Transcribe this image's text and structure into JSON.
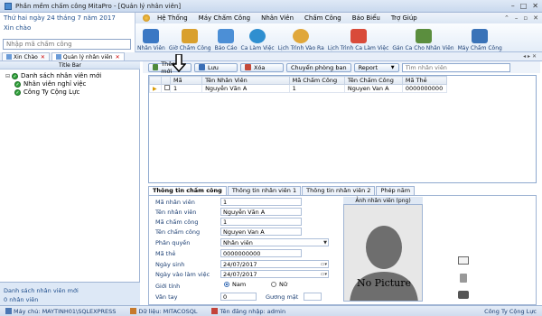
{
  "window": {
    "title": "Phần mềm chấm công MitaPro - [Quản lý nhân viên]"
  },
  "left_header": {
    "date": "Thứ hai ngày 24 tháng 7 năm 2017",
    "greeting": "Xin chào",
    "search_placeholder": "Nhập mã chấm công"
  },
  "menu": {
    "items": [
      "Hệ Thống",
      "Máy Chấm Công",
      "Nhân Viên",
      "Chấm Công",
      "Báo Biểu",
      "Trợ Giúp"
    ]
  },
  "ribbon": {
    "buttons": [
      {
        "label": "Nhân Viên",
        "color": "#3b78c4"
      },
      {
        "label": "Giờ Chấm Công",
        "color": "#d9a02e"
      },
      {
        "label": "Báo Cáo",
        "color": "#4c8fd6"
      },
      {
        "label": "Ca Làm Việc",
        "color": "#2f8fd0"
      },
      {
        "label": "Lịch Trình Vào Ra",
        "color": "#e0a73b"
      },
      {
        "label": "Lịch Trình Ca Làm Việc",
        "color": "#d94b3a"
      },
      {
        "label": "Gán Ca Cho Nhân Viên",
        "color": "#5b8e3e"
      },
      {
        "label": "Máy Chấm Công",
        "color": "#3a73b8"
      }
    ]
  },
  "doc_tabs": [
    {
      "label": "Xin Chào"
    },
    {
      "label": "Quản lý nhân viên"
    }
  ],
  "tree": {
    "header": "Title Bar",
    "items": [
      "Danh sách nhân viên mới",
      "Nhân viên nghỉ việc",
      "Công Ty Cộng Lực"
    ]
  },
  "left_footer": {
    "line1": "Danh sách nhân viên mới",
    "line2": "0 nhân viên"
  },
  "toolbar": {
    "add": "Thêm mới",
    "save": "Lưu",
    "delete": "Xóa",
    "transfer": "Chuyển phòng ban",
    "report": "Report",
    "search_placeholder": "Tìm nhân viên"
  },
  "grid": {
    "columns": [
      "Mã",
      "Tên Nhân Viên",
      "Mã Chấm Công",
      "Tên Chấm Công",
      "Mã Thẻ"
    ],
    "rows": [
      [
        "1",
        "Nguyễn Văn A",
        "1",
        "Nguyen Van A",
        "0000000000"
      ]
    ]
  },
  "detail_tabs": [
    "Thông tin chấm công",
    "Thông tin nhân viên 1",
    "Thông tin nhân viên 2",
    "Phép năm"
  ],
  "form": {
    "ma_nv_label": "Mã nhân viên",
    "ma_nv": "1",
    "ten_nv_label": "Tên nhân viên",
    "ten_nv": "Nguyễn Văn A",
    "ma_cc_label": "Mã chấm công",
    "ma_cc": "1",
    "ten_cc_label": "Tên chấm công",
    "ten_cc": "Nguyen Van A",
    "phan_quyen_label": "Phân quyền",
    "phan_quyen": "Nhân viên",
    "ma_the_label": "Mã thẻ",
    "ma_the": "0000000000",
    "ngay_sinh_label": "Ngày sinh",
    "ngay_sinh": "24/07/2017",
    "ngay_vao_label": "Ngày vào làm việc",
    "ngay_vao": "24/07/2017",
    "gioi_tinh_label": "Giới tính",
    "nam": "Nam",
    "nu": "Nữ",
    "van_tay_label": "Vân tay",
    "van_tay": "0",
    "guong_mat_label": "Gương mặt"
  },
  "photo": {
    "header": "Ảnh nhân viên (png)",
    "placeholder": "No Picture"
  },
  "status": {
    "machine": "Máy chủ: MAYTINH01\\SQLEXPRESS",
    "db": "Dữ liệu: MITACOSQL",
    "user": "Tên đăng nhập: admin",
    "company": "Công Ty Cộng Lực"
  }
}
